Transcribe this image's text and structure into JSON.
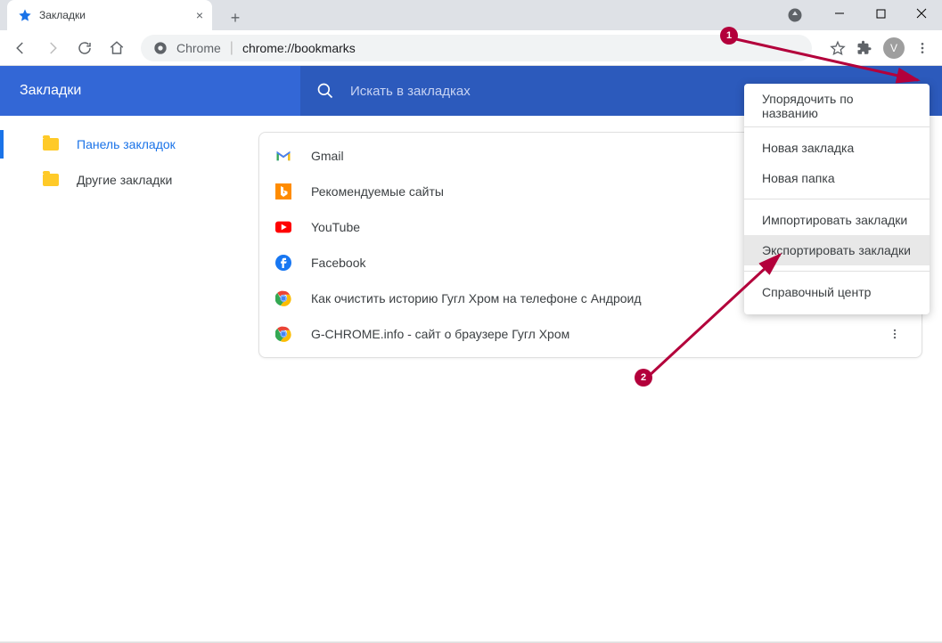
{
  "tab": {
    "title": "Закладки"
  },
  "omnibox": {
    "label": "Chrome",
    "url": "chrome://bookmarks"
  },
  "avatar": {
    "initial": "V"
  },
  "header": {
    "title": "Закладки",
    "search_placeholder": "Искать в закладках"
  },
  "sidebar": {
    "items": [
      {
        "label": "Панель закладок"
      },
      {
        "label": "Другие закладки"
      }
    ]
  },
  "bookmarks": [
    {
      "label": "Gmail"
    },
    {
      "label": "Рекомендуемые сайты"
    },
    {
      "label": "YouTube"
    },
    {
      "label": "Facebook"
    },
    {
      "label": "Как очистить историю Гугл Хром на телефоне с Андроид"
    },
    {
      "label": "G-CHROME.info - сайт о браузере Гугл Хром"
    }
  ],
  "menu": {
    "sort": "Упорядочить по названию",
    "new_bookmark": "Новая закладка",
    "new_folder": "Новая папка",
    "import": "Импортировать закладки",
    "export": "Экспортировать закладки",
    "help": "Справочный центр"
  },
  "annotations": {
    "badge1": "1",
    "badge2": "2"
  }
}
